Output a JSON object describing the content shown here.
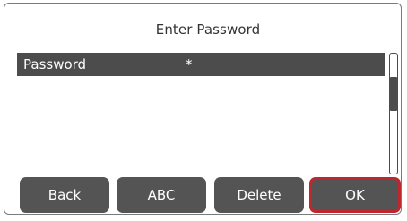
{
  "dialog": {
    "title": "Enter Password"
  },
  "list": {
    "rows": [
      {
        "label": "Password",
        "value": "*"
      }
    ]
  },
  "buttons": {
    "back": "Back",
    "abc": "ABC",
    "delete": "Delete",
    "ok": "OK"
  },
  "colors": {
    "highlight_row": "#4c4c4c",
    "button": "#545454",
    "focus_border": "#c0262d"
  }
}
